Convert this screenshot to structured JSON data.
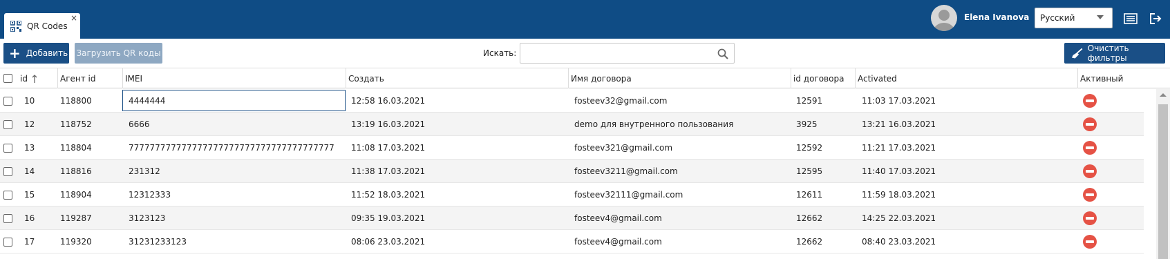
{
  "header": {
    "tab_label": "QR Codes",
    "tab_close": "×",
    "user_name": "Elena Ivanova",
    "language": "Русский",
    "icons": [
      "qr-code-icon",
      "avatar",
      "list-icon",
      "logout-icon"
    ],
    "brand_color": "#0f4c85"
  },
  "toolbar": {
    "add_label": "Добавить",
    "upload_label": "Загрузить QR коды",
    "search_label": "Искать:",
    "search_value": "",
    "clear_label": "Очистить фильтры"
  },
  "table": {
    "columns": [
      "id",
      "Агент id",
      "IMEI",
      "Создать",
      "Имя договора",
      "id договора",
      "Activated",
      "Активный"
    ],
    "sort": {
      "column": "id",
      "direction": "ascending"
    },
    "rows": [
      {
        "id": "10",
        "agent": "118800",
        "imei": "4444444",
        "created": "12:58 16.03.2021",
        "contract_name": "fosteev32@gmail.com",
        "contract_id": "12591",
        "activated": "11:03 17.03.2021",
        "active": "false"
      },
      {
        "id": "12",
        "agent": "118752",
        "imei": "6666",
        "created": "13:19 16.03.2021",
        "contract_name": "demo для внутренного пользования",
        "contract_id": "3925",
        "activated": "13:21 16.03.2021",
        "active": "false"
      },
      {
        "id": "13",
        "agent": "118804",
        "imei": "777777777777777777777777777777777777777",
        "created": "11:08 17.03.2021",
        "contract_name": "fosteev321@gmail.com",
        "contract_id": "12592",
        "activated": "11:21 17.03.2021",
        "active": "false"
      },
      {
        "id": "14",
        "agent": "118816",
        "imei": "231312",
        "created": "11:38 17.03.2021",
        "contract_name": "fosteev3211@gmail.com",
        "contract_id": "12595",
        "activated": "11:40 17.03.2021",
        "active": "false"
      },
      {
        "id": "15",
        "agent": "118904",
        "imei": "12312333",
        "created": "11:52 18.03.2021",
        "contract_name": "fosteev32111@gmail.com",
        "contract_id": "12611",
        "activated": "11:59 18.03.2021",
        "active": "false"
      },
      {
        "id": "16",
        "agent": "119287",
        "imei": "3123123",
        "created": "09:35 19.03.2021",
        "contract_name": "fosteev4@gmail.com",
        "contract_id": "12662",
        "activated": "14:25 22.03.2021",
        "active": "false"
      },
      {
        "id": "17",
        "agent": "119320",
        "imei": "31231233123",
        "created": "08:06 23.03.2021",
        "contract_name": "fosteev4@gmail.com",
        "contract_id": "12662",
        "activated": "08:40 23.03.2021",
        "active": "false"
      }
    ],
    "editing_row": 0,
    "inactive_icon_color": "#e55245"
  }
}
